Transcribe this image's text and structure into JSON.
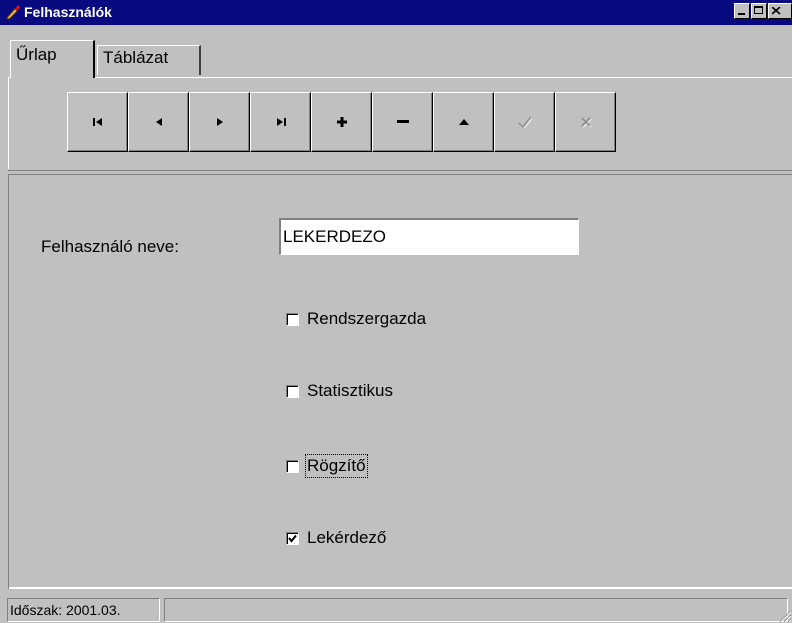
{
  "window": {
    "title": "Felhasználók",
    "colors": {
      "titlebar": "#0a0a80",
      "face": "#c0c0c0"
    }
  },
  "tabs": [
    {
      "label": "Űrlap",
      "active": true
    },
    {
      "label": "Táblázat",
      "active": false
    }
  ],
  "toolbar": {
    "buttons": [
      {
        "icon": "first-record-icon",
        "enabled": true
      },
      {
        "icon": "prior-record-icon",
        "enabled": true
      },
      {
        "icon": "next-record-icon",
        "enabled": true
      },
      {
        "icon": "last-record-icon",
        "enabled": true
      },
      {
        "icon": "insert-record-icon",
        "enabled": true
      },
      {
        "icon": "delete-record-icon",
        "enabled": true
      },
      {
        "icon": "edit-record-icon",
        "enabled": true
      },
      {
        "icon": "post-edit-icon",
        "enabled": false
      },
      {
        "icon": "cancel-edit-icon",
        "enabled": false
      }
    ]
  },
  "form": {
    "name_label": "Felhasználó neve:",
    "name_value": "LEKERDEZO",
    "checkboxes": [
      {
        "label": "Rendszergazda",
        "checked": false
      },
      {
        "label": "Statisztikus",
        "checked": false
      },
      {
        "label": "Rögzítő",
        "checked": false,
        "focused": true
      },
      {
        "label": "Lekérdező",
        "checked": true
      }
    ]
  },
  "statusbar": {
    "period": "Időszak: 2001.03."
  }
}
